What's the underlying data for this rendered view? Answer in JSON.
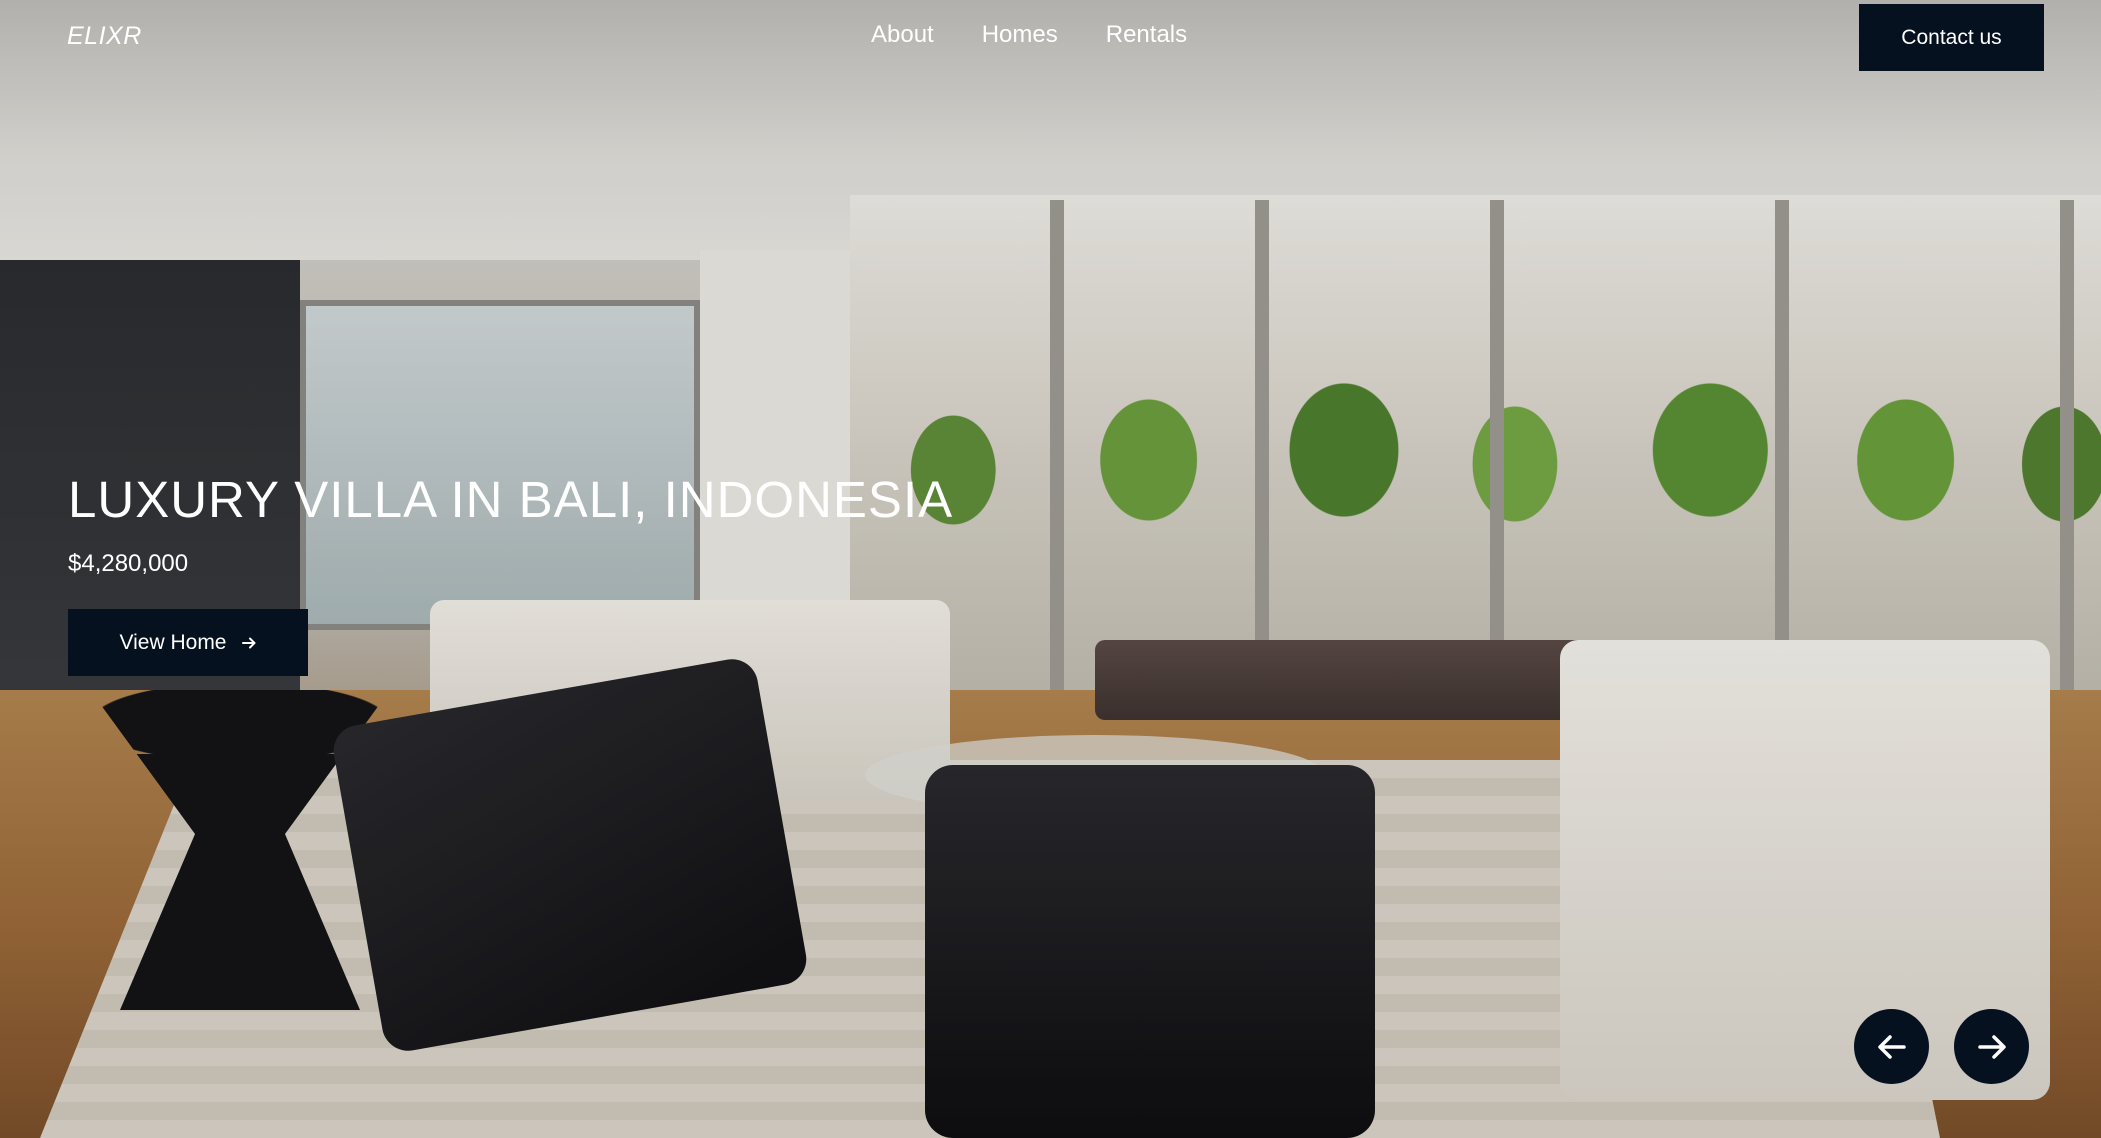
{
  "brand": {
    "logo_text": "ELIXR"
  },
  "nav": {
    "links": [
      {
        "label": "About"
      },
      {
        "label": "Homes"
      },
      {
        "label": "Rentals"
      }
    ],
    "contact_label": "Contact us"
  },
  "hero": {
    "title": "LUXURY VILLA IN BALI, INDONESIA",
    "price": "$4,280,000",
    "cta_label": "View Home",
    "cta_icon": "arrow-right-icon",
    "background_image_alt": "Modern living room with glass doors opening to a garden patio"
  },
  "carousel": {
    "prev_icon": "arrow-left-icon",
    "next_icon": "arrow-right-icon"
  },
  "colors": {
    "button_bg": "#06111f",
    "text": "#ffffff"
  }
}
